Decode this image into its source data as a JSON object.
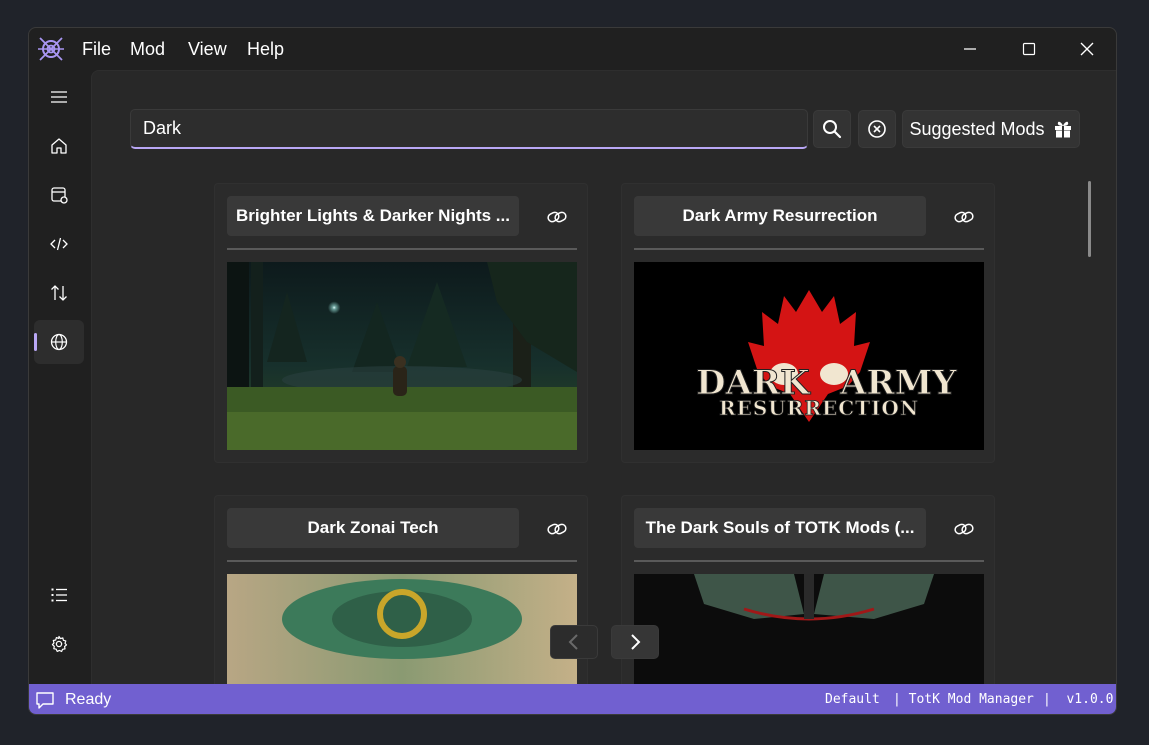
{
  "menu": [
    "File",
    "Mod",
    "View",
    "Help"
  ],
  "search": {
    "value": "Dark",
    "placeholder": ""
  },
  "toolbar": {
    "suggested_label": "Suggested Mods"
  },
  "mods": [
    {
      "title": "Brighter Lights & Darker Nights ..."
    },
    {
      "title": "Dark Army Resurrection",
      "banner_line1": "DARK",
      "banner_line1b": "ARMY",
      "banner_line2": "RESURRECTION"
    },
    {
      "title": "Dark Zonai Tech"
    },
    {
      "title": "The Dark Souls of TOTK Mods (..."
    }
  ],
  "status": {
    "text": "Ready",
    "profile": "Default",
    "app": "| TotK Mod Manager",
    "version": "|  v1.0.0"
  },
  "colors": {
    "accent": "#b9a7f5",
    "statusbar": "#7160d0",
    "background": "#202020"
  }
}
